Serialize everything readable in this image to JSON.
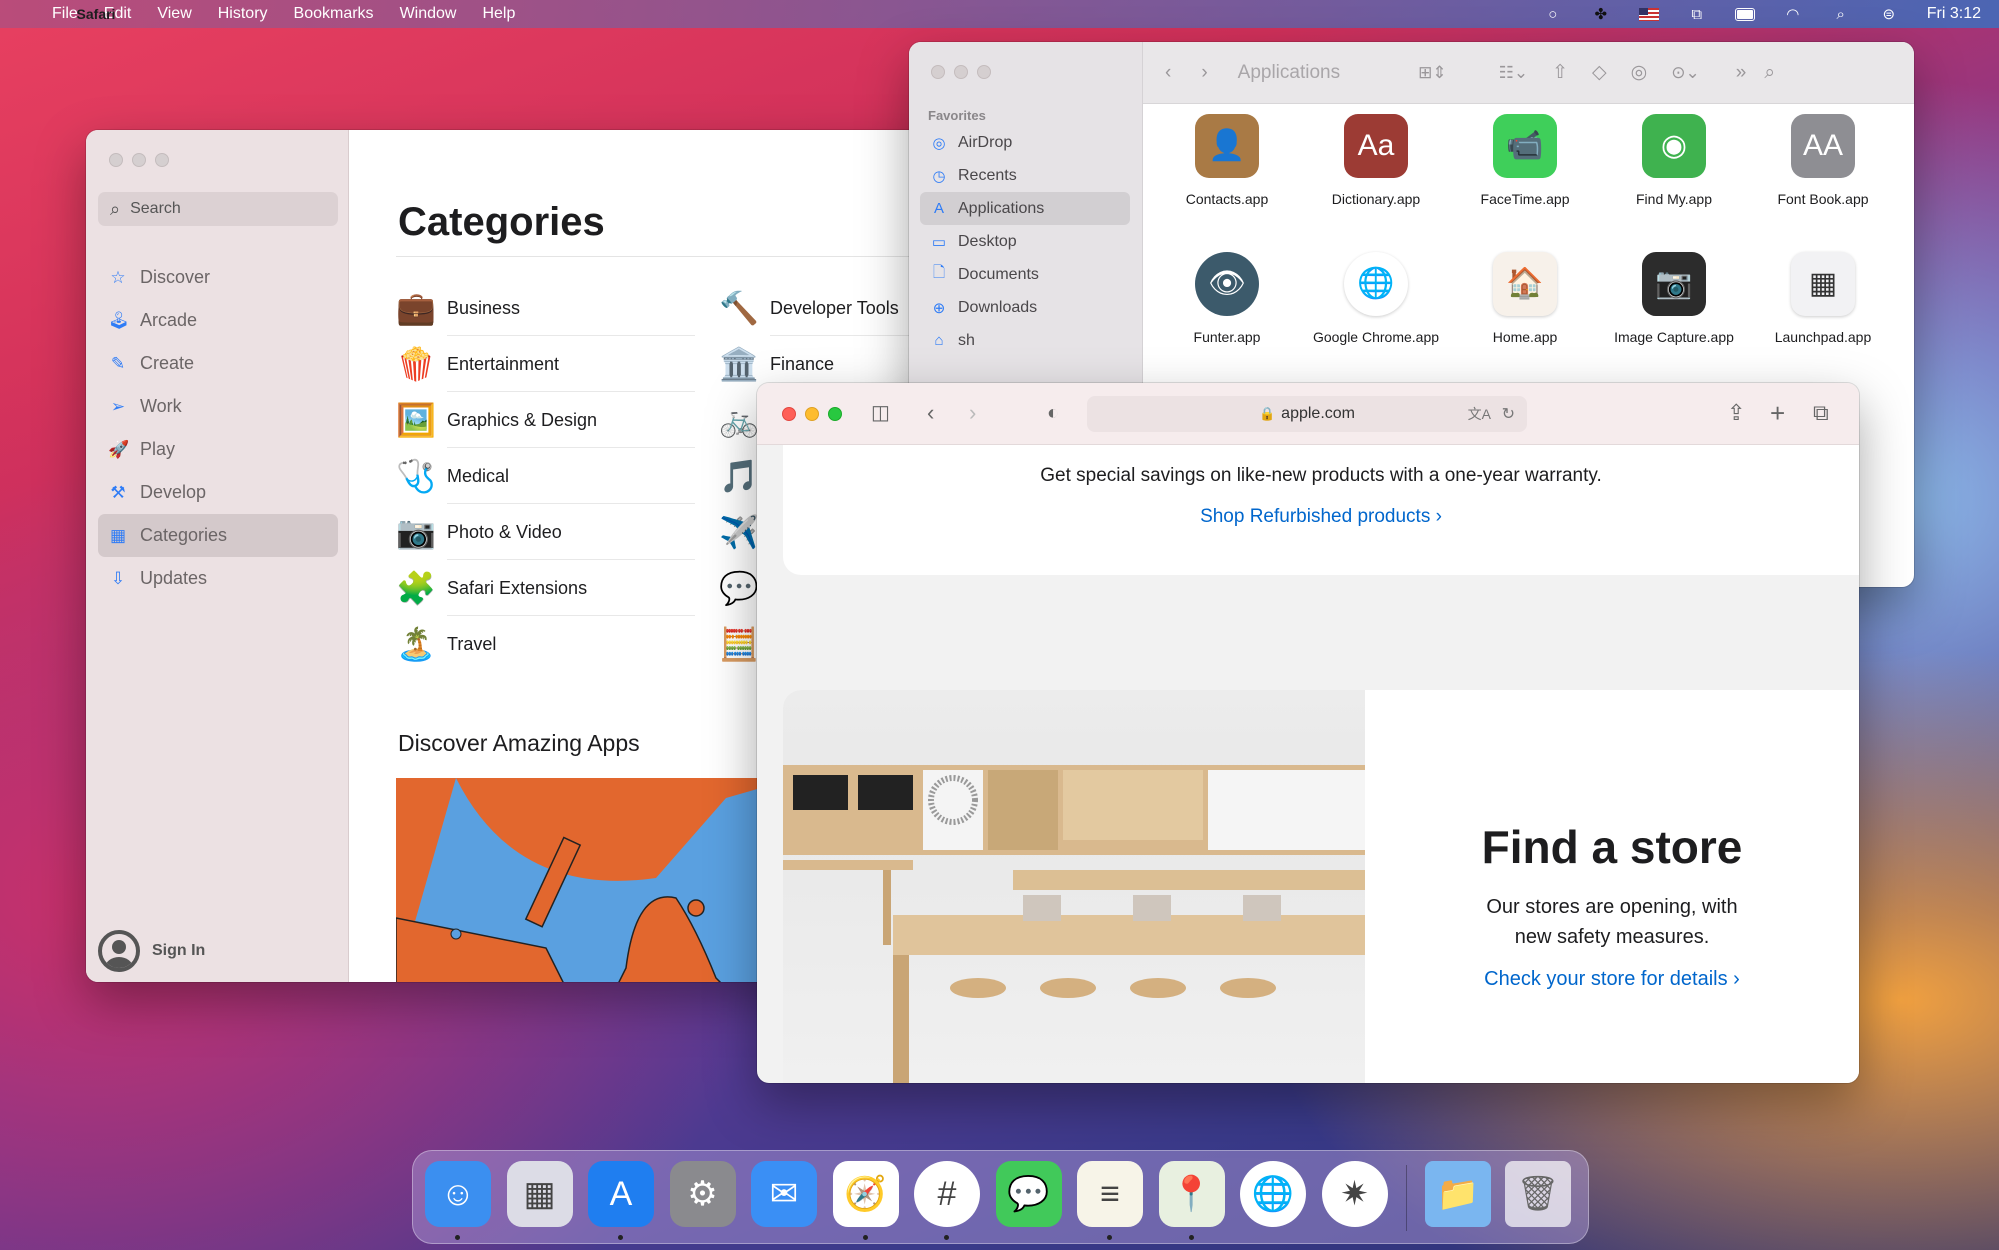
{
  "menubar": {
    "app": "Safari",
    "items": [
      "File",
      "Edit",
      "View",
      "History",
      "Bookmarks",
      "Window",
      "Help"
    ],
    "status_icons": [
      "circle-icon",
      "splashtop-icon",
      "us-flag-icon",
      "screen-mirror-icon",
      "battery-icon",
      "wifi-icon",
      "spotlight-icon",
      "control-center-icon"
    ],
    "clock": "Fri 3:12"
  },
  "appstore": {
    "search_placeholder": "Search",
    "nav": [
      {
        "label": "Discover",
        "icon": "star-icon"
      },
      {
        "label": "Arcade",
        "icon": "joystick-icon"
      },
      {
        "label": "Create",
        "icon": "brush-icon"
      },
      {
        "label": "Work",
        "icon": "paperplane-icon"
      },
      {
        "label": "Play",
        "icon": "rocket-icon"
      },
      {
        "label": "Develop",
        "icon": "hammer-icon"
      },
      {
        "label": "Categories",
        "icon": "grid-icon",
        "selected": true
      },
      {
        "label": "Updates",
        "icon": "download-icon"
      }
    ],
    "signin": "Sign In",
    "title": "Categories",
    "categories_left": [
      {
        "label": "Business",
        "icon": "💼"
      },
      {
        "label": "Entertainment",
        "icon": "🍿"
      },
      {
        "label": "Graphics & Design",
        "icon": "🖼️"
      },
      {
        "label": "Medical",
        "icon": "🩺"
      },
      {
        "label": "Photo & Video",
        "icon": "📷"
      },
      {
        "label": "Safari Extensions",
        "icon": "🧩"
      },
      {
        "label": "Travel",
        "icon": "🏝️"
      }
    ],
    "categories_right": [
      {
        "label": "Developer Tools",
        "icon": "🔨"
      },
      {
        "label": "Finance",
        "icon": "🏛️"
      },
      {
        "label": "",
        "icon": "🚲"
      },
      {
        "label": "",
        "icon": "🎵"
      },
      {
        "label": "",
        "icon": "✈️"
      },
      {
        "label": "",
        "icon": "💬"
      },
      {
        "label": "",
        "icon": "🧮"
      }
    ],
    "discover_heading": "Discover Amazing Apps"
  },
  "finder": {
    "title": "Applications",
    "favorites_header": "Favorites",
    "sidebar": [
      {
        "label": "AirDrop",
        "icon": "airdrop-icon"
      },
      {
        "label": "Recents",
        "icon": "clock-icon"
      },
      {
        "label": "Applications",
        "icon": "applications-icon",
        "selected": true
      },
      {
        "label": "Desktop",
        "icon": "desktop-icon"
      },
      {
        "label": "Documents",
        "icon": "document-icon"
      },
      {
        "label": "Downloads",
        "icon": "downloads-icon"
      },
      {
        "label": "sh",
        "icon": "home-icon"
      }
    ],
    "apps": [
      {
        "name": "Contacts.app",
        "color": "#a97a45",
        "glyph": "👤"
      },
      {
        "name": "Dictionary.app",
        "color": "#9c3b34",
        "glyph": "Aa"
      },
      {
        "name": "FaceTime.app",
        "color": "#3fcf5a",
        "glyph": "📹"
      },
      {
        "name": "Find My.app",
        "color": "#3fb24f",
        "glyph": "◉"
      },
      {
        "name": "Font Book.app",
        "color": "#8e8e93",
        "glyph": "AA"
      },
      {
        "name": "Funter.app",
        "color": "#3c5a6b",
        "glyph": "👁"
      },
      {
        "name": "Google Chrome.app",
        "color": "#ffffff",
        "glyph": "🌐"
      },
      {
        "name": "Home.app",
        "color": "#f7f1ea",
        "glyph": "🏠"
      },
      {
        "name": "Image Capture.app",
        "color": "#2c2c2c",
        "glyph": "📷"
      },
      {
        "name": "Launchpad.app",
        "color": "#f2f2f4",
        "glyph": "▦"
      }
    ]
  },
  "safari": {
    "url": "apple.com",
    "refurb_text": "Get special savings on like-new products with a one-year warranty.",
    "refurb_link": "Shop Refurbished products ›",
    "store_heading": "Find a store",
    "store_text": "Our stores are opening, with new safety measures.",
    "store_link": "Check your store for details ›"
  },
  "dock": {
    "apps": [
      {
        "name": "Finder",
        "color": "#3b8ff0",
        "glyph": "☺",
        "running": true
      },
      {
        "name": "Launchpad",
        "color": "#dcdce6",
        "glyph": "▦",
        "running": false
      },
      {
        "name": "App Store",
        "color": "#1f7ef0",
        "glyph": "A",
        "running": true
      },
      {
        "name": "System Preferences",
        "color": "#8a8a8e",
        "glyph": "⚙",
        "running": false
      },
      {
        "name": "Mail",
        "color": "#3a8ff5",
        "glyph": "✉",
        "running": false
      },
      {
        "name": "Safari",
        "color": "#ffffff",
        "glyph": "🧭",
        "running": true
      },
      {
        "name": "Slack",
        "color": "#ffffff",
        "glyph": "#",
        "running": true
      },
      {
        "name": "Messages",
        "color": "#41c95a",
        "glyph": "💬",
        "running": false
      },
      {
        "name": "Notes",
        "color": "#f7f4e8",
        "glyph": "≡",
        "running": true
      },
      {
        "name": "Maps",
        "color": "#e8f0e0",
        "glyph": "📍",
        "running": true
      },
      {
        "name": "Google Chrome",
        "color": "#ffffff",
        "glyph": "🌐",
        "running": false
      },
      {
        "name": "MacCleaner",
        "color": "#ffffff",
        "glyph": "✷",
        "running": false
      }
    ],
    "extras": [
      {
        "name": "Applications Folder",
        "glyph": "📁"
      },
      {
        "name": "Trash",
        "glyph": "🗑"
      }
    ]
  }
}
